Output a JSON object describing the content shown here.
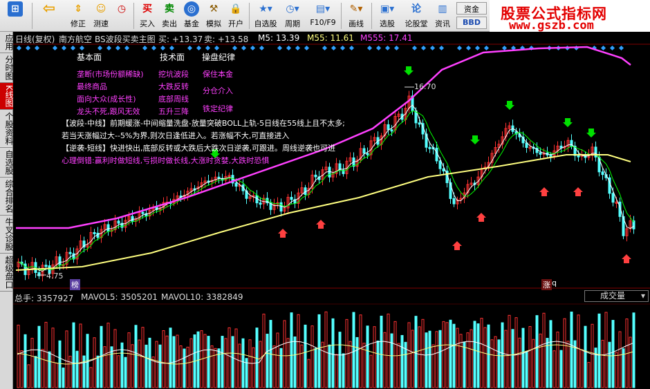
{
  "toolbar": {
    "buttons": [
      {
        "label": "",
        "icon": "back-arrow"
      },
      {
        "label": "修正",
        "icon": "up-down-arrows"
      },
      {
        "label": "测速",
        "icon": "smiley"
      },
      {
        "label": "",
        "icon": "clock"
      },
      {
        "label": "买入",
        "icon": "买"
      },
      {
        "label": "卖出",
        "icon": "卖"
      },
      {
        "label": "基金",
        "icon": "globe"
      },
      {
        "label": "模拟",
        "icon": "hammer"
      },
      {
        "label": "开户",
        "icon": "lock"
      },
      {
        "label": "自选股",
        "icon": "star-folder"
      },
      {
        "label": "周期",
        "icon": "clock"
      },
      {
        "label": "F10/F9",
        "icon": "chart-doc"
      },
      {
        "label": "画线",
        "icon": "pencil"
      },
      {
        "label": "选股",
        "icon": "screen"
      },
      {
        "label": "论股堂",
        "icon": "论"
      },
      {
        "label": "资讯",
        "icon": "doc"
      }
    ],
    "extra": {
      "capital": "资金",
      "bbd": "BBD"
    }
  },
  "brand": {
    "title": "股票公式指标网",
    "url": "www.gszb.com"
  },
  "sidebar": {
    "tabs": [
      "应用",
      "分时图",
      "K线图",
      "个股资料",
      "自选股",
      "综合排名",
      "牛叉诊股",
      "超级盘口"
    ],
    "active": 2
  },
  "header": {
    "period": "日线(复权)",
    "stock": "南方航空",
    "indicator": "BS波段买卖主图",
    "buy": "买: +13.37",
    "sell": "卖: +13.58",
    "ma5": "M5: 13.39",
    "ma55": "M55: 11.61",
    "ma555": "M555: 17.41"
  },
  "notes": {
    "col1_title": "基本面",
    "col1": [
      "垄断(市场份额稀缺)",
      "最终商品",
      "面向大众(成长性)",
      "龙头不死,跟风无效"
    ],
    "col2_title": "技术面",
    "col2": [
      "挖坑波段",
      "大跌反转",
      "底部周线",
      "五升三降"
    ],
    "col3_title": "操盘纪律",
    "col3": [
      "保住本金",
      "分仓介入",
      "铁定纪律"
    ],
    "line1": "【波段-中线】前期缓涨-中间缩量洗盘-放量突破BOLL上轨-5日线在55线上且不太多;",
    "line2": "若当天涨幅过大--5%为界,则次日逢低进入。若涨幅不大,可直接进入",
    "line3": "【逆袭-短线】快进快出,底部反转或大跌后大跌次日逆袭,可跟进。周线逆袭也可进",
    "line4": "心理倒错:赢利时做短线,亏损时做长线,大涨时贪婪,大跌时恐惧"
  },
  "markers": {
    "high": "16.70",
    "low": "4.75",
    "bang": "榜",
    "zhang": "涨",
    "q": "q"
  },
  "volume": {
    "total": "总手: 3357927",
    "mavol5": "MAVOL5: 3505201",
    "mavol10": "MAVOL10: 3382849",
    "select": "成交量"
  },
  "colors": {
    "up": "#ff3232",
    "down": "#54ffff",
    "ma5": "#ffffff",
    "ma55": "#ffff80",
    "ma555": "#ff40ff",
    "green": "#00ff00",
    "text": "#ff40ff"
  }
}
